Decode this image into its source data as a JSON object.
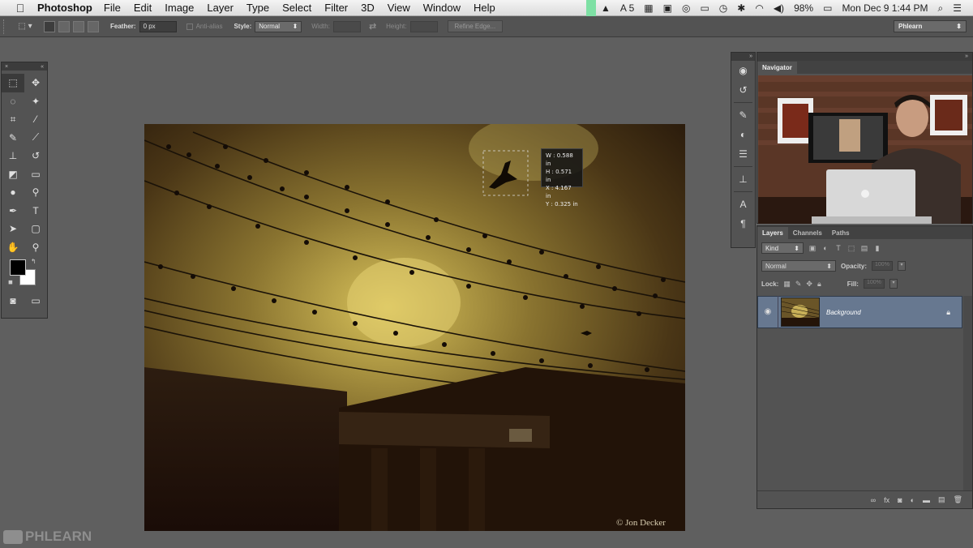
{
  "menubar": {
    "app": "Photoshop",
    "items": [
      "File",
      "Edit",
      "Image",
      "Layer",
      "Type",
      "Select",
      "Filter",
      "3D",
      "View",
      "Window",
      "Help"
    ],
    "status_5": "5",
    "battery": "98%",
    "clock": "Mon Dec 9  1:44 PM"
  },
  "options": {
    "feather_label": "Feather:",
    "feather_value": "0 px",
    "antialias_label": "Anti-alias",
    "style_label": "Style:",
    "style_value": "Normal",
    "width_label": "Width:",
    "height_label": "Height:",
    "refine_edge": "Refine Edge...",
    "workspace": "Phlearn"
  },
  "readout": {
    "w": "W : 0.588 in",
    "h": "H : 0.571 in",
    "x": "X : 4.167 in",
    "y": "Y : 0.325 in"
  },
  "canvas": {
    "credit": "© Jon Decker"
  },
  "navigator": {
    "tab": "Navigator"
  },
  "layers": {
    "tabs": [
      "Layers",
      "Channels",
      "Paths"
    ],
    "kind": "Kind",
    "blend": "Normal",
    "opacity_label": "Opacity:",
    "opacity_value": "100%",
    "lock_label": "Lock:",
    "fill_label": "Fill:",
    "fill_value": "100%",
    "layer_name": "Background"
  },
  "watermark": "PHLEARN",
  "colors": {
    "foreground": "#000000",
    "background": "#ffffff",
    "selected_layer": "#677890"
  }
}
